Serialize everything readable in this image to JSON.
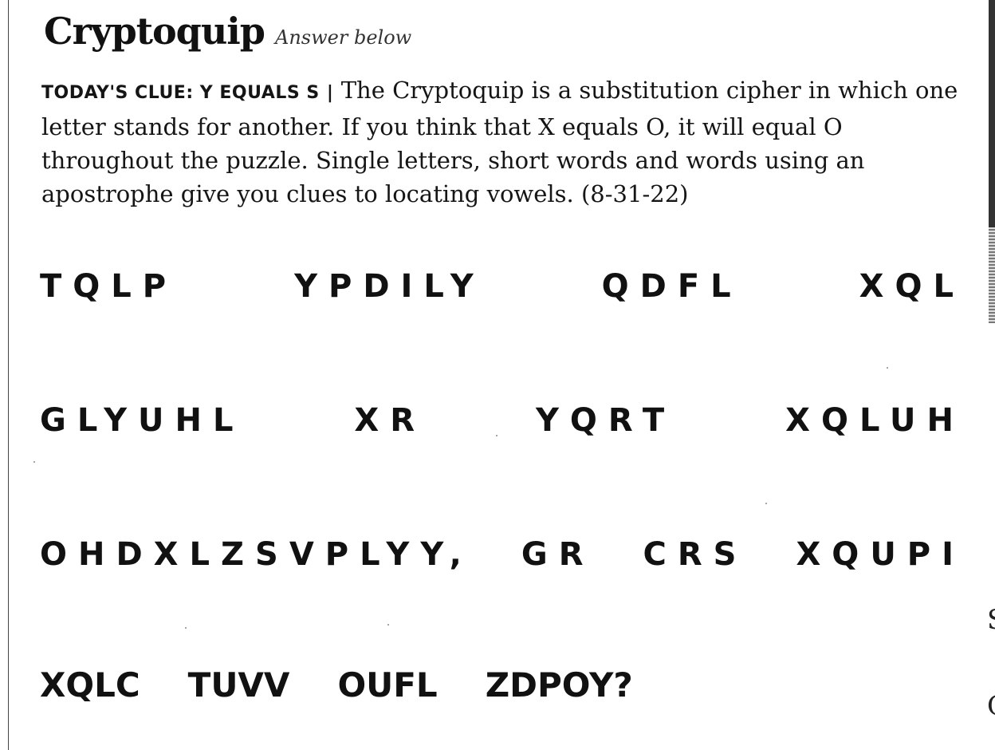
{
  "header": {
    "title": "Cryptoquip",
    "subtitle": "Answer below"
  },
  "clue": {
    "label": "TODAY'S CLUE: Y EQUALS S",
    "separator": "|",
    "text": "The Cryptoquip is a substitution cipher in which one letter stands for another. If you think that X equals O, it will equal O throughout the puzzle. Single letters, short words and words using an apostrophe give you clues to locating vowels. (8-31-22)"
  },
  "puzzle": {
    "lines": [
      [
        "TQLP",
        "YPDILY",
        "QDFL",
        "XQL"
      ],
      [
        "GLYUHL",
        "XR",
        "YQRT",
        "XQLUH"
      ],
      [
        "OHDXLZSVPLYY,",
        "GR",
        "CRS",
        "XQUPI"
      ],
      [
        "XQLC",
        "TUVV",
        "OUFL",
        "ZDPOY?"
      ]
    ]
  },
  "edge_glyphs": [
    "S",
    "C"
  ]
}
